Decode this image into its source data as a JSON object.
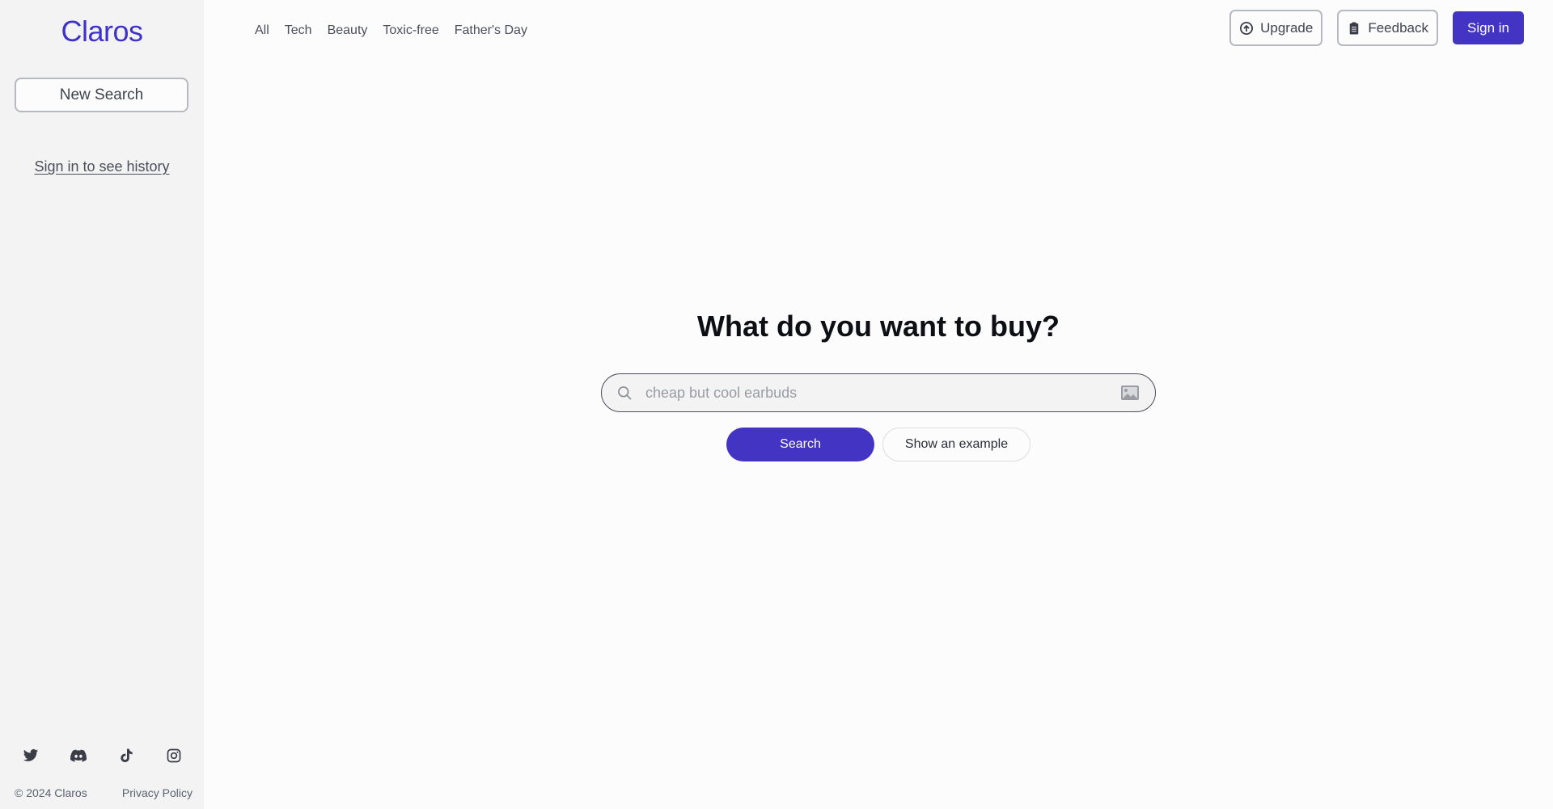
{
  "sidebar": {
    "logo": "Claros",
    "new_search_label": "New Search",
    "history_link": "Sign in to see history",
    "socials": [
      {
        "icon": "twitter-icon"
      },
      {
        "icon": "discord-icon"
      },
      {
        "icon": "tiktok-icon"
      },
      {
        "icon": "instagram-icon"
      }
    ],
    "footer": {
      "copyright": "© 2024 Claros",
      "privacy": "Privacy Policy"
    }
  },
  "topnav": {
    "tabs": [
      {
        "label": "All"
      },
      {
        "label": "Tech"
      },
      {
        "label": "Beauty"
      },
      {
        "label": "Toxic-free"
      },
      {
        "label": "Father's Day"
      }
    ]
  },
  "header_actions": {
    "upgrade_label": "Upgrade",
    "feedback_label": "Feedback",
    "signin_label": "Sign in"
  },
  "main": {
    "title": "What do you want to buy?",
    "search": {
      "value": "",
      "placeholder": "cheap but cool earbuds"
    },
    "search_button": "Search",
    "example_button": "Show an example"
  },
  "colors": {
    "brand": "#4334c4",
    "sidebar_bg": "#f3f3f3",
    "page_bg": "#fcfcfc"
  }
}
